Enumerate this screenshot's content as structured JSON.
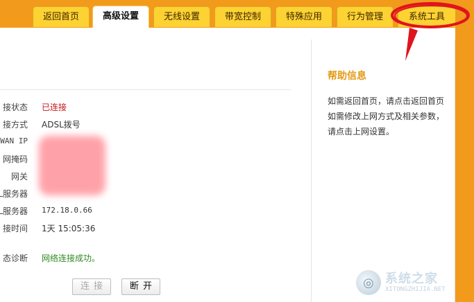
{
  "tabs": [
    {
      "label": "返回首页",
      "active": false
    },
    {
      "label": "高级设置",
      "active": true
    },
    {
      "label": "无线设置",
      "active": false
    },
    {
      "label": "带宽控制",
      "active": false
    },
    {
      "label": "特殊应用",
      "active": false
    },
    {
      "label": "行为管理",
      "active": false
    },
    {
      "label": "系统工具",
      "active": false
    }
  ],
  "wan": {
    "status_label": "接状态",
    "status_value": "已连接",
    "method_label": "接方式",
    "method_value": "ADSL拨号",
    "ip_label": "WAN IP",
    "mask_label": "网掩码",
    "gateway_label": "网关",
    "dns1_label": "L服务器",
    "dns2_label": "L服务器",
    "dns2_value": "172.18.0.66",
    "time_label": "接时间",
    "time_value": "1天 15:05:36",
    "diag_label": "态诊断",
    "diag_value": "网络连接成功。"
  },
  "buttons": {
    "connect": "连接",
    "disconnect": "断开"
  },
  "help": {
    "title": "帮助信息",
    "text": "如需返回首页，请点击返回首页\n如需修改上网方式及相关参数，请点击上网设置。"
  },
  "watermark": {
    "logo_glyph": "◎",
    "name": "系统之家",
    "url": "XITONGZHIJIA.NET"
  },
  "colors": {
    "header_orange": "#f29a1c",
    "tab_yellow": "#fdd233",
    "help_title": "#e39a16",
    "status_connected": "#c81414",
    "status_ok": "#2e8b22",
    "annotation_red": "#e0141e"
  }
}
